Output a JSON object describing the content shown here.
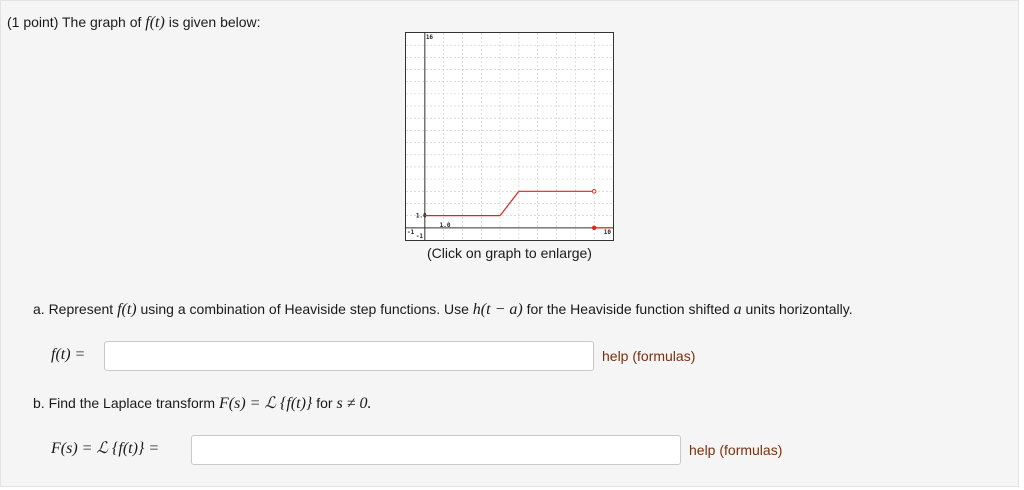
{
  "problem": {
    "points": "(1 point) The graph of",
    "func": "f(t)",
    "intro_tail": "is given below:"
  },
  "graph": {
    "caption": "(Click on graph to enlarge)",
    "labels": {
      "y_max": "16",
      "x_min": "-1",
      "y_min": "-1",
      "x_max": "10",
      "y_one": "1.0",
      "x_one": "1.0"
    },
    "line_color": "#e0241b",
    "x_range": [
      -1,
      10
    ],
    "y_range": [
      -1,
      16
    ],
    "piecewise": [
      {
        "from": 0,
        "to": 4,
        "value": 1
      },
      {
        "from": 4,
        "to": 5,
        "ramp": [
          1,
          3
        ]
      },
      {
        "from": 5,
        "to": 9,
        "value": 3,
        "open_end": true
      },
      {
        "from": 9,
        "to": 10,
        "value": 0,
        "closed_start": true
      }
    ]
  },
  "part_a": {
    "label_prefix": "a. Represent",
    "func": "f(t)",
    "text_1": "using a combination of Heaviside step functions. Use",
    "heaviside": "h(t − a)",
    "text_2": "for the Heaviside function shifted",
    "var": "a",
    "text_3": "units horizontally.",
    "lhs": "f(t) =",
    "input_value": "",
    "help": "help (formulas)"
  },
  "part_b": {
    "label_prefix": "b. Find the Laplace transform",
    "transform": "F(s) = ℒ {f(t)}",
    "for_text": "for",
    "condition": "s ≠ 0.",
    "lhs": "F(s) = ℒ {f(t)} =",
    "input_value": "",
    "help": "help (formulas)"
  }
}
